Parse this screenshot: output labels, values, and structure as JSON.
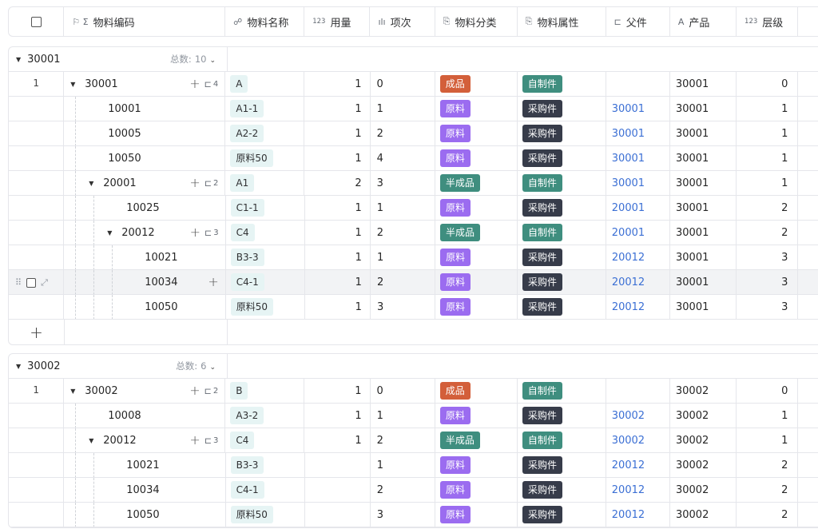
{
  "header": {
    "columns": [
      {
        "key": "select",
        "label": "",
        "icon": "checkbox"
      },
      {
        "key": "code",
        "label": "物料编码",
        "icon": "flag-sigma-icon",
        "glyph": "⚐ Σ"
      },
      {
        "key": "name",
        "label": "物料名称",
        "icon": "link-icon",
        "glyph": "☍"
      },
      {
        "key": "qty",
        "label": "用量",
        "icon": "number-icon",
        "glyph": "123"
      },
      {
        "key": "seq",
        "label": "项次",
        "icon": "bar-chart-icon",
        "glyph": "ılı"
      },
      {
        "key": "category",
        "label": "物料分类",
        "icon": "lookup-icon",
        "glyph": "⎘"
      },
      {
        "key": "attribute",
        "label": "物料属性",
        "icon": "lookup-icon",
        "glyph": "⎘"
      },
      {
        "key": "parent",
        "label": "父件",
        "icon": "tree-icon",
        "glyph": "⊏"
      },
      {
        "key": "product",
        "label": "产品",
        "icon": "text-icon",
        "glyph": "A"
      },
      {
        "key": "level",
        "label": "层级",
        "icon": "number-icon",
        "glyph": "123"
      }
    ]
  },
  "colors": {
    "成品": "#d35f3a",
    "原料": "#9b6cf0",
    "半成品": "#3f8e7f",
    "自制件": "#3f8e7f",
    "采购件": "#373c4a",
    "link": "#3b6fd4"
  },
  "groups": [
    {
      "title": "30001",
      "count_label": "总数:",
      "count": "10",
      "row_number": "1",
      "add_label": "+",
      "rows": [
        {
          "indent": 0,
          "expanded": true,
          "code": "30001",
          "children": "4",
          "name": "A",
          "qty": "1",
          "seq": "0",
          "category": "成品",
          "attribute": "自制件",
          "parent": "",
          "product": "30001",
          "level": "0"
        },
        {
          "indent": 1,
          "code": "10001",
          "name": "A1-1",
          "qty": "1",
          "seq": "1",
          "category": "原料",
          "attribute": "采购件",
          "parent": "30001",
          "product": "30001",
          "level": "1"
        },
        {
          "indent": 1,
          "code": "10005",
          "name": "A2-2",
          "qty": "1",
          "seq": "2",
          "category": "原料",
          "attribute": "采购件",
          "parent": "30001",
          "product": "30001",
          "level": "1"
        },
        {
          "indent": 1,
          "code": "10050",
          "name": "原料50",
          "qty": "1",
          "seq": "4",
          "category": "原料",
          "attribute": "采购件",
          "parent": "30001",
          "product": "30001",
          "level": "1"
        },
        {
          "indent": 1,
          "expanded": true,
          "code": "20001",
          "children": "2",
          "name": "A1",
          "qty": "2",
          "seq": "3",
          "category": "半成品",
          "attribute": "自制件",
          "parent": "30001",
          "product": "30001",
          "level": "1"
        },
        {
          "indent": 2,
          "code": "10025",
          "name": "C1-1",
          "qty": "1",
          "seq": "1",
          "category": "原料",
          "attribute": "采购件",
          "parent": "20001",
          "product": "30001",
          "level": "2"
        },
        {
          "indent": 2,
          "expanded": true,
          "code": "20012",
          "children": "3",
          "name": "C4",
          "qty": "1",
          "seq": "2",
          "category": "半成品",
          "attribute": "自制件",
          "parent": "20001",
          "product": "30001",
          "level": "2"
        },
        {
          "indent": 3,
          "code": "10021",
          "name": "B3-3",
          "qty": "1",
          "seq": "1",
          "category": "原料",
          "attribute": "采购件",
          "parent": "20012",
          "product": "30001",
          "level": "3"
        },
        {
          "indent": 3,
          "code": "10034",
          "name": "C4-1",
          "qty": "1",
          "seq": "2",
          "category": "原料",
          "attribute": "采购件",
          "parent": "20012",
          "product": "30001",
          "level": "3",
          "hover": true
        },
        {
          "indent": 3,
          "code": "10050",
          "name": "原料50",
          "qty": "1",
          "seq": "3",
          "category": "原料",
          "attribute": "采购件",
          "parent": "20012",
          "product": "30001",
          "level": "3"
        }
      ]
    },
    {
      "title": "30002",
      "count_label": "总数:",
      "count": "6",
      "row_number": "1",
      "rows": [
        {
          "indent": 0,
          "expanded": true,
          "code": "30002",
          "children": "2",
          "name": "B",
          "qty": "1",
          "seq": "0",
          "category": "成品",
          "attribute": "自制件",
          "parent": "",
          "product": "30002",
          "level": "0"
        },
        {
          "indent": 1,
          "code": "10008",
          "name": "A3-2",
          "qty": "1",
          "seq": "1",
          "category": "原料",
          "attribute": "采购件",
          "parent": "30002",
          "product": "30002",
          "level": "1"
        },
        {
          "indent": 1,
          "expanded": true,
          "code": "20012",
          "children": "3",
          "name": "C4",
          "qty": "1",
          "seq": "2",
          "category": "半成品",
          "attribute": "自制件",
          "parent": "30002",
          "product": "30002",
          "level": "1"
        },
        {
          "indent": 2,
          "code": "10021",
          "name": "B3-3",
          "qty": "",
          "seq": "1",
          "category": "原料",
          "attribute": "采购件",
          "parent": "20012",
          "product": "30002",
          "level": "2"
        },
        {
          "indent": 2,
          "code": "10034",
          "name": "C4-1",
          "qty": "",
          "seq": "2",
          "category": "原料",
          "attribute": "采购件",
          "parent": "20012",
          "product": "30002",
          "level": "2"
        },
        {
          "indent": 2,
          "code": "10050",
          "name": "原料50",
          "qty": "",
          "seq": "3",
          "category": "原料",
          "attribute": "采购件",
          "parent": "20012",
          "product": "30002",
          "level": "2"
        }
      ]
    }
  ]
}
